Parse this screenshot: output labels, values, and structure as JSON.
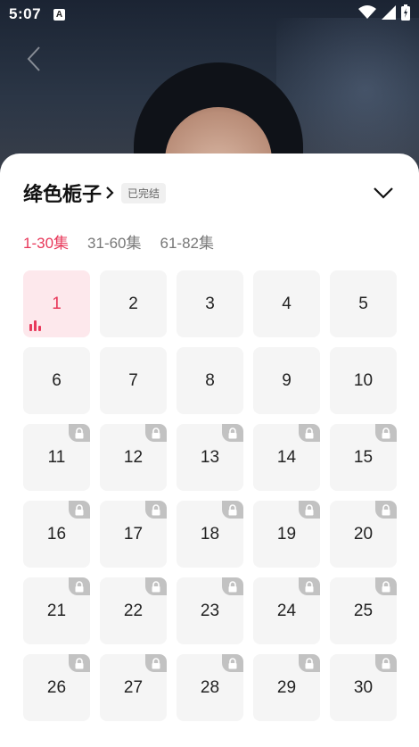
{
  "status_bar": {
    "time": "5:07",
    "notification_letter": "A",
    "icons": [
      "wifi-icon",
      "signal-icon",
      "battery-icon"
    ]
  },
  "sheet": {
    "title": "绛色栀子",
    "badge": "已完结",
    "tabs": [
      {
        "label": "1-30集",
        "active": true
      },
      {
        "label": "31-60集",
        "active": false
      },
      {
        "label": "61-82集",
        "active": false
      }
    ],
    "episodes": [
      {
        "num": "1",
        "locked": false,
        "active": true
      },
      {
        "num": "2",
        "locked": false,
        "active": false
      },
      {
        "num": "3",
        "locked": false,
        "active": false
      },
      {
        "num": "4",
        "locked": false,
        "active": false
      },
      {
        "num": "5",
        "locked": false,
        "active": false
      },
      {
        "num": "6",
        "locked": false,
        "active": false
      },
      {
        "num": "7",
        "locked": false,
        "active": false
      },
      {
        "num": "8",
        "locked": false,
        "active": false
      },
      {
        "num": "9",
        "locked": false,
        "active": false
      },
      {
        "num": "10",
        "locked": false,
        "active": false
      },
      {
        "num": "11",
        "locked": true,
        "active": false
      },
      {
        "num": "12",
        "locked": true,
        "active": false
      },
      {
        "num": "13",
        "locked": true,
        "active": false
      },
      {
        "num": "14",
        "locked": true,
        "active": false
      },
      {
        "num": "15",
        "locked": true,
        "active": false
      },
      {
        "num": "16",
        "locked": true,
        "active": false
      },
      {
        "num": "17",
        "locked": true,
        "active": false
      },
      {
        "num": "18",
        "locked": true,
        "active": false
      },
      {
        "num": "19",
        "locked": true,
        "active": false
      },
      {
        "num": "20",
        "locked": true,
        "active": false
      },
      {
        "num": "21",
        "locked": true,
        "active": false
      },
      {
        "num": "22",
        "locked": true,
        "active": false
      },
      {
        "num": "23",
        "locked": true,
        "active": false
      },
      {
        "num": "24",
        "locked": true,
        "active": false
      },
      {
        "num": "25",
        "locked": true,
        "active": false
      },
      {
        "num": "26",
        "locked": true,
        "active": false
      },
      {
        "num": "27",
        "locked": true,
        "active": false
      },
      {
        "num": "28",
        "locked": true,
        "active": false
      },
      {
        "num": "29",
        "locked": true,
        "active": false
      },
      {
        "num": "30",
        "locked": true,
        "active": false
      }
    ]
  },
  "colors": {
    "accent": "#e8385a",
    "active_tile": "#fde8ec",
    "tile": "#f5f5f5",
    "lock_tag": "#c2c2c2"
  }
}
